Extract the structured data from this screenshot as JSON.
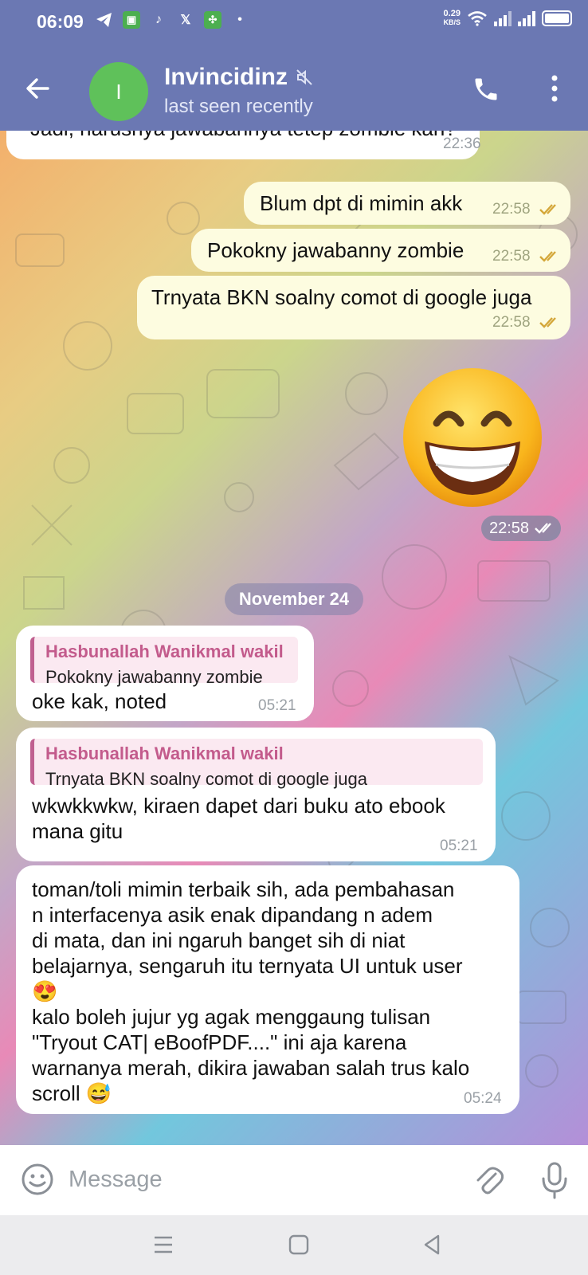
{
  "status_bar": {
    "time": "06:09",
    "net_speed_value": "0.29",
    "net_speed_unit": "KB/S",
    "app_icons": [
      "telegram-icon",
      "messages-icon",
      "tiktok-icon",
      "x-icon",
      "app-icon",
      "dot"
    ]
  },
  "header": {
    "name": "Invincidinz",
    "status": "last seen recently",
    "avatar_letter": "I",
    "avatar_color": "#5fc15a",
    "bar_color": "#6b78b3"
  },
  "messages": [
    {
      "id": "m0",
      "dir": "in",
      "text": "Jadi, harusnya jawabannya tetep zombie kan?",
      "time": "22:36"
    },
    {
      "id": "m1",
      "dir": "out",
      "text": "Blum dpt di mimin akk",
      "time": "22:58"
    },
    {
      "id": "m2",
      "dir": "out",
      "text": "Pokokny jawabanny zombie",
      "time": "22:58"
    },
    {
      "id": "m3",
      "dir": "out",
      "text": "Trnyata BKN soalny comot di google juga",
      "time": "22:58"
    },
    {
      "id": "m4",
      "dir": "out",
      "sticker": "grinning-face-with-smiling-eyes",
      "time": "22:58"
    },
    {
      "id": "m5",
      "dir": "in",
      "reply_name": "Hasbunallah Wanikmal wakil",
      "reply_text": "Pokokny jawabanny zombie",
      "text": "oke kak, noted",
      "time": "05:21"
    },
    {
      "id": "m6",
      "dir": "in",
      "reply_name": "Hasbunallah Wanikmal wakil",
      "reply_text": "Trnyata BKN soalny comot di google juga",
      "text_lines": [
        "wkwkkwkw, kiraen dapet dari buku ato ebook",
        "mana gitu"
      ],
      "time": "05:21"
    },
    {
      "id": "m7",
      "dir": "in",
      "text_lines": [
        "toman/toli mimin terbaik sih, ada pembahasan",
        "n interfacenya asik enak dipandang n adem",
        "di mata, dan ini ngaruh banget sih di niat",
        "belajarnya, sengaruh itu ternyata UI untuk user",
        "😍",
        "kalo boleh jujur yg agak menggaung tulisan",
        "\"Tryout CAT| eBoofPDF....\" ini aja karena",
        "warnanya merah, dikira jawaban salah trus kalo",
        "scroll 😅"
      ],
      "time": "05:24"
    }
  ],
  "date_separator": "November 24",
  "input": {
    "placeholder": "Message"
  },
  "colors": {
    "accent": "#6b78b3",
    "reply_name": "#c35b8c",
    "check": "#d4a73a"
  }
}
